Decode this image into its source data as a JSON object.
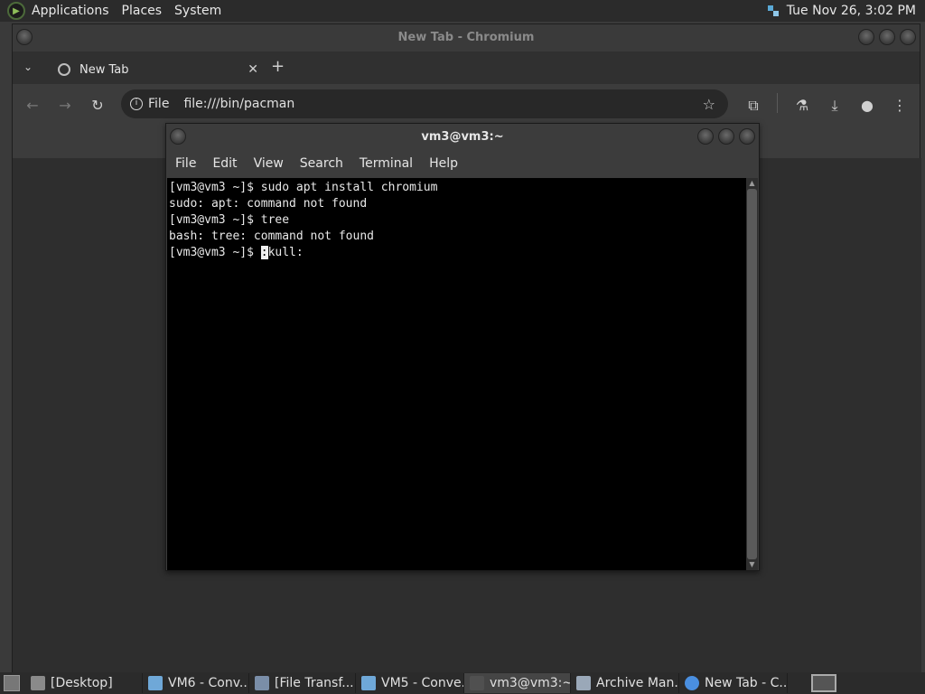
{
  "top_panel": {
    "menus": [
      "Applications",
      "Places",
      "System"
    ],
    "clock": "Tue Nov 26,  3:02 PM"
  },
  "browser": {
    "window_title": "New Tab - Chromium",
    "tab": {
      "title": "New Tab"
    },
    "omnibox": {
      "scheme_label": "File",
      "url": "file:///bin/pacman"
    }
  },
  "terminal": {
    "window_title": "vm3@vm3:~",
    "menus": [
      "File",
      "Edit",
      "View",
      "Search",
      "Terminal",
      "Help"
    ],
    "lines": [
      "[vm3@vm3 ~]$ sudo apt install chromium",
      "sudo: apt: command not found",
      "[vm3@vm3 ~]$ tree",
      "bash: tree: command not found"
    ],
    "prompt": "[vm3@vm3 ~]$ ",
    "current_input": "skull:",
    "cursor_char": ":"
  },
  "taskbar": {
    "items": [
      {
        "label": "[Desktop]",
        "icon": "folder-icon",
        "active": false
      },
      {
        "label": "VM6 - Conv...",
        "icon": "vm-icon",
        "active": false
      },
      {
        "label": "[File Transf...",
        "icon": "file-transfer-icon",
        "active": false
      },
      {
        "label": "VM5 - Conve...",
        "icon": "vm-icon",
        "active": false
      },
      {
        "label": "vm3@vm3:~",
        "icon": "terminal-icon",
        "active": true
      },
      {
        "label": "Archive Man...",
        "icon": "archive-icon",
        "active": false
      },
      {
        "label": "New Tab - C...",
        "icon": "chromium-icon",
        "active": false
      }
    ]
  }
}
